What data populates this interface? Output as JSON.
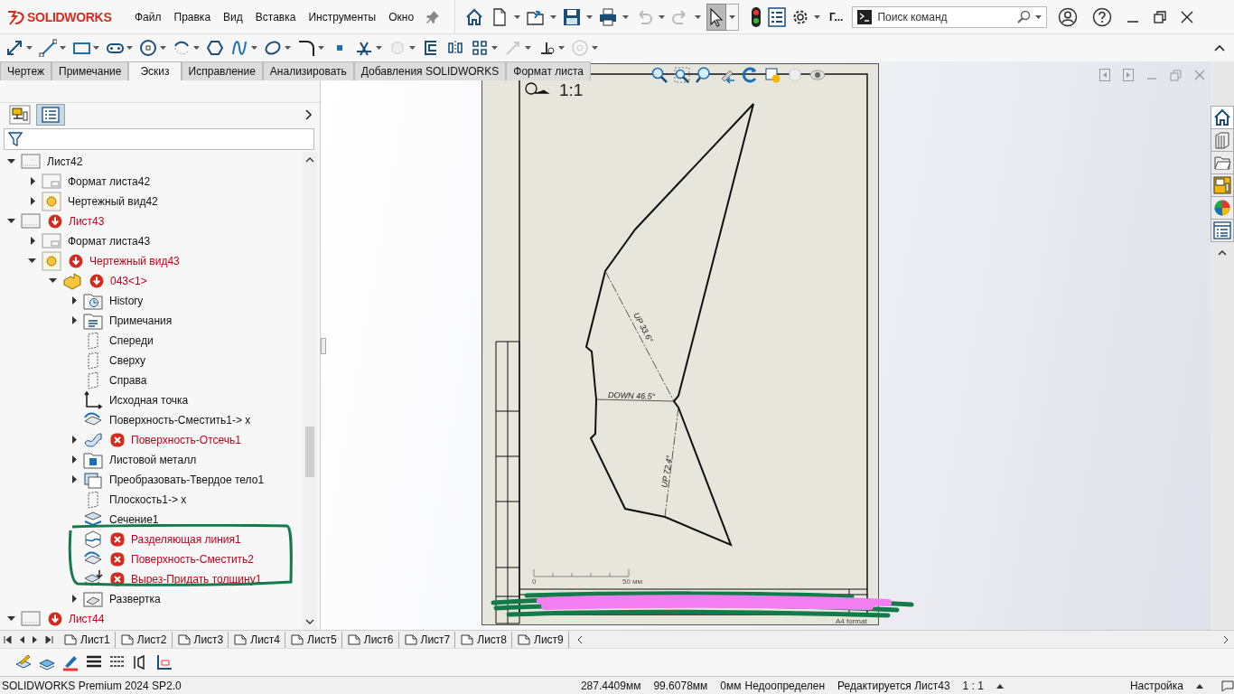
{
  "app": {
    "logo": "SOLIDWORKS",
    "menu": [
      "Файл",
      "Правка",
      "Вид",
      "Вставка",
      "Инструменты",
      "Окно"
    ],
    "overflow": "Г...",
    "search": {
      "placeholder": "Поиск команд"
    }
  },
  "tabs": [
    {
      "label": "Чертеж",
      "selected": false
    },
    {
      "label": "Примечание",
      "selected": false
    },
    {
      "label": "Эскиз",
      "selected": true
    },
    {
      "label": "Исправление",
      "selected": false
    },
    {
      "label": "Анализировать",
      "selected": false
    },
    {
      "label": "Добавления SOLIDWORKS",
      "selected": false
    },
    {
      "label": "Формат листа",
      "selected": false
    }
  ],
  "tree": [
    {
      "label": "Лист42",
      "kind": "sheet",
      "rebuild": false,
      "error": false,
      "expanded": true,
      "children": [
        {
          "label": "Формат листа42",
          "kind": "format",
          "rebuild": false,
          "error": false,
          "expanded": false
        },
        {
          "label": "Чертежный вид42",
          "kind": "view",
          "rebuild": false,
          "error": false,
          "expanded": false
        }
      ]
    },
    {
      "label": "Лист43",
      "kind": "sheet",
      "rebuild": true,
      "error": false,
      "expanded": true,
      "children": [
        {
          "label": "Формат листа43",
          "kind": "format",
          "rebuild": false,
          "error": false,
          "expanded": false
        },
        {
          "label": "Чертежный вид43",
          "kind": "view",
          "rebuild": true,
          "error": false,
          "expanded": true,
          "children": [
            {
              "label": "043<1>",
              "kind": "part",
              "rebuild": true,
              "error": false,
              "expanded": true,
              "children": [
                {
                  "label": "History",
                  "kind": "history",
                  "rebuild": false,
                  "error": false,
                  "expanded": false
                },
                {
                  "label": "Примечания",
                  "kind": "annotations",
                  "rebuild": false,
                  "error": false,
                  "expanded": false
                },
                {
                  "label": "Спереди",
                  "kind": "plane",
                  "rebuild": false,
                  "error": false
                },
                {
                  "label": "Сверху",
                  "kind": "plane",
                  "rebuild": false,
                  "error": false
                },
                {
                  "label": "Справа",
                  "kind": "plane",
                  "rebuild": false,
                  "error": false
                },
                {
                  "label": "Исходная точка",
                  "kind": "origin",
                  "rebuild": false,
                  "error": false
                },
                {
                  "label": "Поверхность-Сместить1-> x",
                  "kind": "surface",
                  "rebuild": false,
                  "error": false
                },
                {
                  "label": "Поверхность-Отсечь1",
                  "kind": "trim",
                  "rebuild": false,
                  "error": true,
                  "expanded": false
                },
                {
                  "label": "Листовой металл",
                  "kind": "sheetmetal",
                  "rebuild": false,
                  "error": false,
                  "expanded": false
                },
                {
                  "label": "Преобразовать-Твердое тело1",
                  "kind": "convert",
                  "rebuild": false,
                  "error": false,
                  "expanded": false
                },
                {
                  "label": "Плоскость1-> x",
                  "kind": "plane",
                  "rebuild": false,
                  "error": false
                },
                {
                  "label": "Сечение1",
                  "kind": "section",
                  "rebuild": false,
                  "error": false
                },
                {
                  "label": "Разделяющая линия1",
                  "kind": "split",
                  "rebuild": false,
                  "error": true
                },
                {
                  "label": "Поверхность-Сместить2",
                  "kind": "surface",
                  "rebuild": false,
                  "error": true
                },
                {
                  "label": "Вырез-Придать толщину1",
                  "kind": "thicken",
                  "rebuild": false,
                  "error": true
                },
                {
                  "label": "Развертка",
                  "kind": "flatten",
                  "rebuild": false,
                  "error": false,
                  "expanded": false
                }
              ]
            }
          ]
        }
      ]
    },
    {
      "label": "Лист44",
      "kind": "sheet",
      "rebuild": true,
      "error": false,
      "expanded": true
    }
  ],
  "drawing": {
    "view_label": "1:1",
    "bend_notes": [
      "UP 33.6°",
      "DOWN 46.5°",
      "UP 72.4°"
    ],
    "scale_bar": [
      "0",
      "50 мм"
    ],
    "format_label": "A4 format"
  },
  "sheet_tabs": [
    "Лист1",
    "Лист2",
    "Лист3",
    "Лист4",
    "Лист5",
    "Лист6",
    "Лист7",
    "Лист8",
    "Лист9"
  ],
  "status_bar": {
    "product": "SOLIDWORKS Premium 2024 SP2.0",
    "x": "287.4409мм",
    "y": "99.6078мм",
    "z": "0мм",
    "state": "Недоопределен",
    "editing": "Редактируется Лист43",
    "scale": "1 : 1",
    "units": "Настройка"
  }
}
